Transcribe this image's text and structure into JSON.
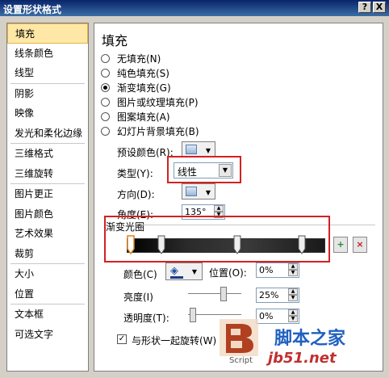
{
  "window": {
    "title": "设置形状格式",
    "help_glyph": "?",
    "close_glyph": "X"
  },
  "sidebar": {
    "items": [
      {
        "label": "填充",
        "selected": true
      },
      {
        "label": "线条颜色"
      },
      {
        "label": "线型"
      },
      {
        "label": "阴影"
      },
      {
        "label": "映像"
      },
      {
        "label": "发光和柔化边缘"
      },
      {
        "label": "三维格式"
      },
      {
        "label": "三维旋转"
      },
      {
        "label": "图片更正"
      },
      {
        "label": "图片颜色"
      },
      {
        "label": "艺术效果"
      },
      {
        "label": "裁剪"
      },
      {
        "label": "大小"
      },
      {
        "label": "位置"
      },
      {
        "label": "文本框"
      },
      {
        "label": "可选文字"
      }
    ]
  },
  "fill": {
    "heading": "填充",
    "options": [
      {
        "label": "无填充(N)",
        "checked": false
      },
      {
        "label": "纯色填充(S)",
        "checked": false
      },
      {
        "label": "渐变填充(G)",
        "checked": true
      },
      {
        "label": "图片或纹理填充(P)",
        "checked": false
      },
      {
        "label": "图案填充(A)",
        "checked": false
      },
      {
        "label": "幻灯片背景填充(B)",
        "checked": false
      }
    ],
    "preset_label": "预设颜色(R):",
    "type_label": "类型(Y):",
    "type_value": "线性",
    "direction_label": "方向(D):",
    "angle_label": "角度(E):",
    "angle_value": "135°",
    "stops_label": "渐变光圈",
    "color_label": "颜色(C)",
    "position_label": "位置(O):",
    "position_value": "0%",
    "brightness_label": "亮度(I)",
    "brightness_value": "25%",
    "transparency_label": "透明度(T):",
    "transparency_value": "0%",
    "rotate_label": "与形状一起旋转(W)",
    "rotate_checked": true
  },
  "icons": {
    "dropdown": "▼",
    "spin_up": "▲",
    "spin_down": "▼",
    "add_stop": "+",
    "remove_stop": "×",
    "check": "✓",
    "bucket": "◈"
  },
  "watermark": {
    "script": "Script",
    "name": "脚本之家",
    "url": "jb51.net"
  }
}
